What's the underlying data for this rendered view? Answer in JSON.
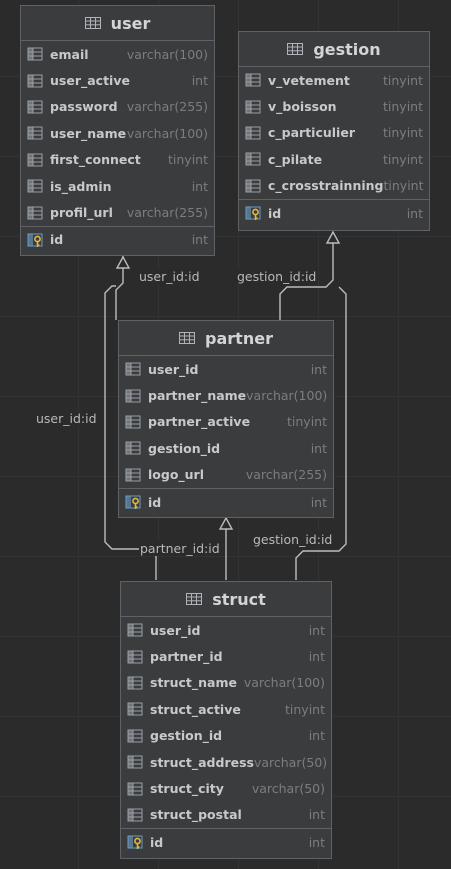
{
  "entities": {
    "user": {
      "title": "user",
      "columns": [
        {
          "name": "email",
          "type": "varchar(100)"
        },
        {
          "name": "user_active",
          "type": "int"
        },
        {
          "name": "password",
          "type": "varchar(255)"
        },
        {
          "name": "user_name",
          "type": "varchar(100)"
        },
        {
          "name": "first_connect",
          "type": "tinyint"
        },
        {
          "name": "is_admin",
          "type": "int"
        },
        {
          "name": "profil_url",
          "type": "varchar(255)"
        }
      ],
      "pk": {
        "name": "id",
        "type": "int"
      }
    },
    "gestion": {
      "title": "gestion",
      "columns": [
        {
          "name": "v_vetement",
          "type": "tinyint"
        },
        {
          "name": "v_boisson",
          "type": "tinyint"
        },
        {
          "name": "c_particulier",
          "type": "tinyint"
        },
        {
          "name": "c_pilate",
          "type": "tinyint"
        },
        {
          "name": "c_crosstrainning",
          "type": "tinyint"
        }
      ],
      "pk": {
        "name": "id",
        "type": "int"
      }
    },
    "partner": {
      "title": "partner",
      "columns": [
        {
          "name": "user_id",
          "type": "int"
        },
        {
          "name": "partner_name",
          "type": "varchar(100)"
        },
        {
          "name": "partner_active",
          "type": "tinyint"
        },
        {
          "name": "gestion_id",
          "type": "int"
        },
        {
          "name": "logo_url",
          "type": "varchar(255)"
        }
      ],
      "pk": {
        "name": "id",
        "type": "int"
      }
    },
    "struct": {
      "title": "struct",
      "columns": [
        {
          "name": "user_id",
          "type": "int"
        },
        {
          "name": "partner_id",
          "type": "int"
        },
        {
          "name": "struct_name",
          "type": "varchar(100)"
        },
        {
          "name": "struct_active",
          "type": "tinyint"
        },
        {
          "name": "gestion_id",
          "type": "int"
        },
        {
          "name": "struct_address",
          "type": "varchar(50)"
        },
        {
          "name": "struct_city",
          "type": "varchar(50)"
        },
        {
          "name": "struct_postal",
          "type": "int"
        }
      ],
      "pk": {
        "name": "id",
        "type": "int"
      }
    }
  },
  "relations": {
    "partner_user": "user_id:id",
    "partner_gestion": "gestion_id:id",
    "struct_user": "user_id:id",
    "struct_partner": "partner_id:id",
    "struct_gestion": "gestion_id:id"
  },
  "colors": {
    "background": "#2b2b2b",
    "entity_bg": "#3a3c3e",
    "border": "#5e6266",
    "line": "#bdbdbd",
    "pk_key": "#e2b93b",
    "column_icon": "#9aa0a6"
  },
  "icons": {
    "table": "table-icon",
    "column": "column-icon",
    "primary_key": "primary-key-icon"
  }
}
